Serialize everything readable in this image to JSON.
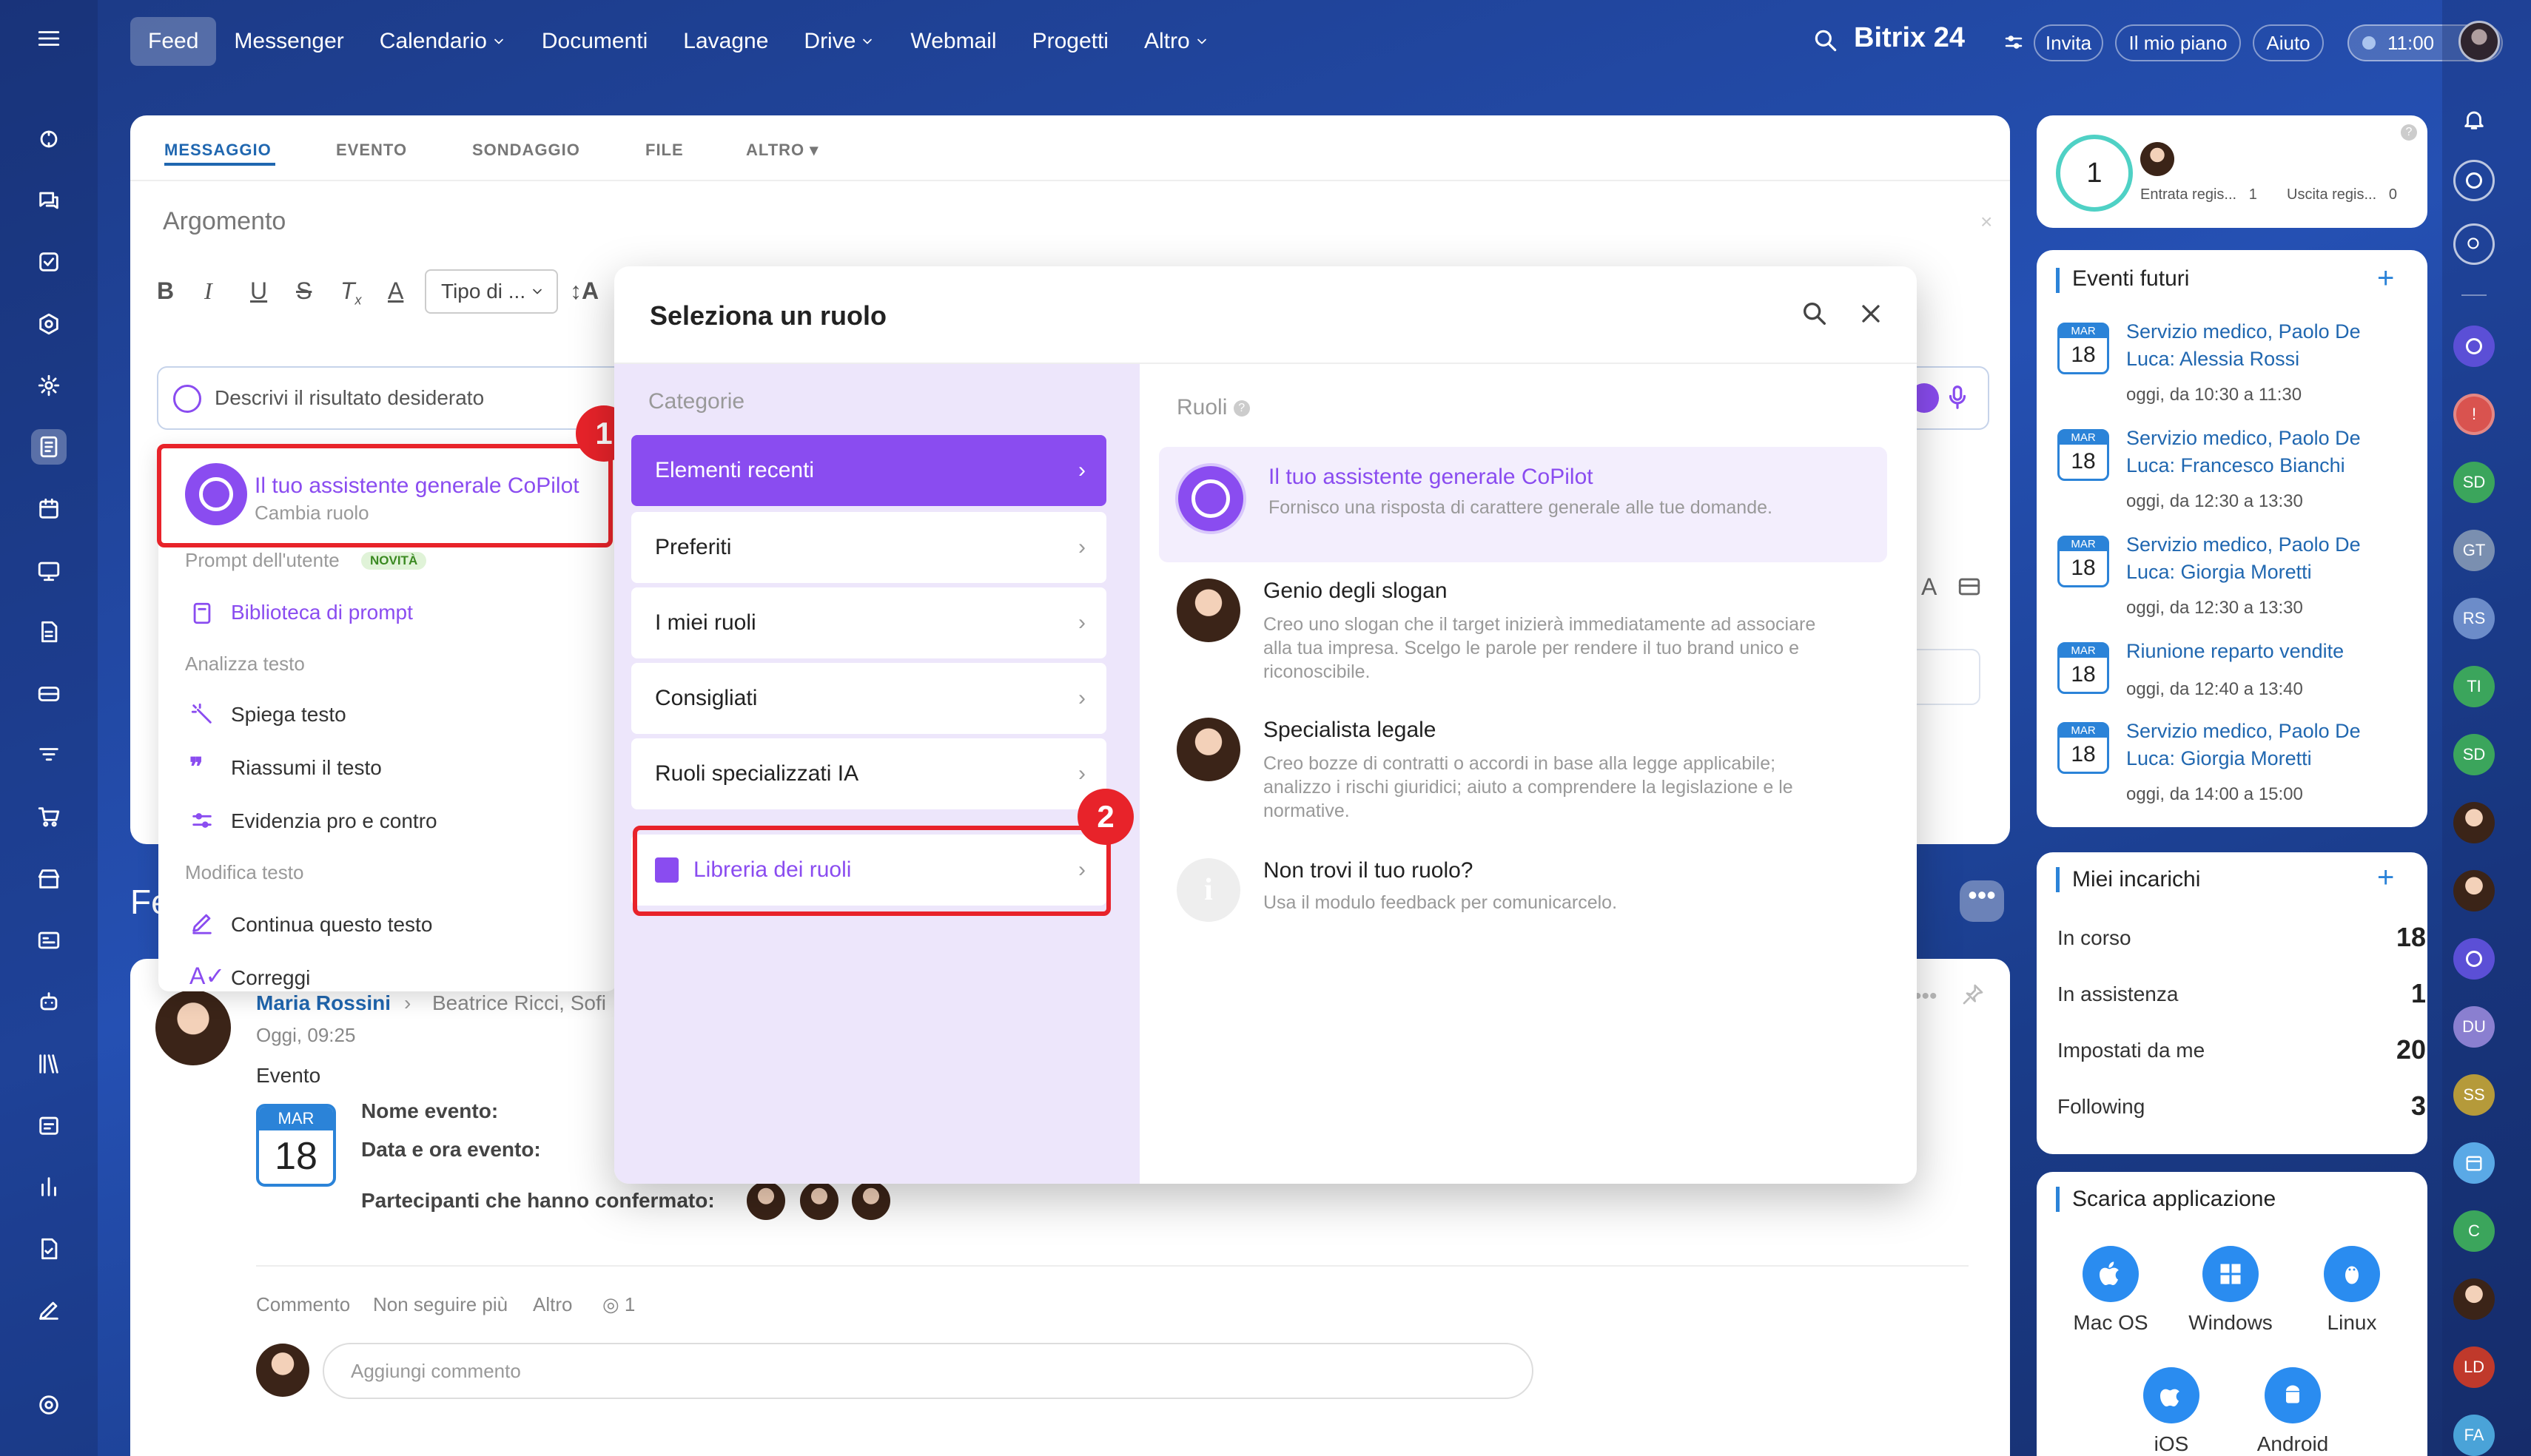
{
  "app": {
    "logo": "Bitrix 24",
    "time": "11:00"
  },
  "nav": {
    "items": [
      "Feed",
      "Messenger",
      "Calendario",
      "Documenti",
      "Lavagne",
      "Drive",
      "Webmail",
      "Progetti",
      "Altro"
    ],
    "invite": "Invita",
    "plan": "Il mio piano",
    "help": "Aiuto"
  },
  "composer": {
    "tabs": [
      "MESSAGGIO",
      "EVENTO",
      "SONDAGGIO",
      "FILE",
      "ALTRO"
    ],
    "subject_placeholder": "Argomento",
    "format_select": "Tipo di ...",
    "copilot_placeholder": "Descrivi il risultato desiderato"
  },
  "copilot_menu": {
    "role_title": "Il tuo assistente generale CoPilot",
    "role_change": "Cambia ruolo",
    "user_prompts": "Prompt dell'utente",
    "new_badge": "NOVITÀ",
    "library": "Biblioteca di prompt",
    "analyze_section": "Analizza testo",
    "explain": "Spiega testo",
    "summarize": "Riassumi il testo",
    "pros_cons": "Evidenzia pro e contro",
    "edit_section": "Modifica testo",
    "continue": "Continua questo testo",
    "correct": "Correggi"
  },
  "role_dialog": {
    "title": "Seleziona un ruolo",
    "categories_label": "Categorie",
    "roles_label": "Ruoli",
    "categories": [
      "Elementi recenti",
      "Preferiti",
      "I miei ruoli",
      "Consigliati",
      "Ruoli specializzati IA"
    ],
    "library": "Libreria dei ruoli",
    "roles": [
      {
        "title": "Il tuo assistente generale CoPilot",
        "desc": "Fornisco una risposta di carattere generale alle tue domande."
      },
      {
        "title": "Genio degli slogan",
        "desc": "Creo uno slogan che il target inizierà immediatamente ad associare alla tua impresa. Scelgo le parole per rendere il tuo brand unico e riconoscibile."
      },
      {
        "title": "Specialista legale",
        "desc": "Creo bozze di contratti o accordi in base alla legge applicabile; analizzo i rischi giuridici; aiuto a comprendere la legislazione e le normative."
      },
      {
        "title": "Non trovi il tuo ruolo?",
        "desc": "Usa il modulo feedback per comunicarcelo."
      }
    ]
  },
  "annotations": {
    "one": "1",
    "two": "2"
  },
  "feed_heading": "Fe",
  "post": {
    "author": "Maria Rossini",
    "recipients": "Beatrice Ricci, Sofi",
    "time": "Oggi, 09:25",
    "type": "Evento",
    "month": "MAR",
    "day": "18",
    "name_label": "Nome evento:",
    "date_label": "Data e ora evento:",
    "participants_label": "Partecipanti che hanno confermato:",
    "actions": [
      "Commento",
      "Non seguire più",
      "Altro"
    ],
    "views": "1",
    "comment_placeholder": "Aggiungi commento"
  },
  "timeman": {
    "count": "1",
    "in_label": "Entrata regis...",
    "in_value": "1",
    "out_label": "Uscita regis...",
    "out_value": "0"
  },
  "events": {
    "title": "Eventi futuri",
    "items": [
      {
        "month": "MAR",
        "day": "18",
        "title": "Servizio medico, Paolo De Luca: Alessia Rossi",
        "time": "oggi, da 10:30 a 11:30"
      },
      {
        "month": "MAR",
        "day": "18",
        "title": "Servizio medico, Paolo De Luca: Francesco Bianchi",
        "time": "oggi, da 12:30 a 13:30"
      },
      {
        "month": "MAR",
        "day": "18",
        "title": "Servizio medico, Paolo De Luca: Giorgia Moretti",
        "time": "oggi, da 12:30 a 13:30"
      },
      {
        "month": "MAR",
        "day": "18",
        "title": "Riunione reparto vendite",
        "time": "oggi, da 12:40 a 13:40"
      },
      {
        "month": "MAR",
        "day": "18",
        "title": "Servizio medico, Paolo De Luca: Giorgia Moretti",
        "time": "oggi, da 14:00 a 15:00"
      }
    ]
  },
  "tasks": {
    "title": "Miei incarichi",
    "items": [
      {
        "label": "In corso",
        "value": "18"
      },
      {
        "label": "In assistenza",
        "value": "1"
      },
      {
        "label": "Impostati da me",
        "value": "20"
      },
      {
        "label": "Following",
        "value": "3"
      }
    ]
  },
  "apps": {
    "title": "Scarica applicazione",
    "items": [
      "Mac OS",
      "Windows",
      "Linux",
      "iOS",
      "Android"
    ]
  },
  "right_rail": {
    "badges": [
      "SD",
      "GT",
      "RS",
      "TI",
      "SD",
      "DU",
      "SS",
      "C",
      "LD",
      "FA"
    ]
  },
  "colors": {
    "accent": "#8a4cf0",
    "link": "#2067b0",
    "annotation": "#e8232a",
    "calendar": "#2b83d8"
  }
}
